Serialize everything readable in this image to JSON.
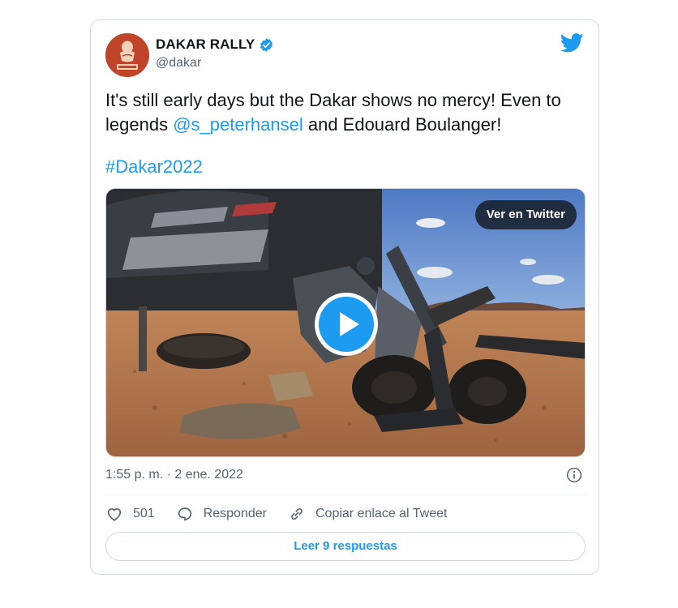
{
  "tweet": {
    "author": {
      "name": "DAKAR RALLY",
      "handle": "@dakar",
      "avatar_icon": "dakar-logo-icon",
      "avatar_color": "#c0442a",
      "verified": true
    },
    "brand_icon": "twitter-bird-icon",
    "text_line1_pre": "It's still early days but the Dakar shows no mercy! Even to",
    "text_line2_pre": "legends ",
    "mention": "@s_peterhansel",
    "text_line2_post": " and Edouard Boulanger!",
    "hashtag": "#Dakar2022",
    "media": {
      "view_label": "Ver en Twitter",
      "play_icon": "play-icon"
    },
    "timestamp": "1:55 p. m. · 2 ene. 2022",
    "info_icon": "info-icon",
    "actions": {
      "like_count": "501",
      "reply_label": "Responder",
      "copy_link_label": "Copiar enlace al Tweet"
    },
    "read_replies_label": "Leer 9 respuestas",
    "colors": {
      "accent": "#1d9bf0",
      "text": "#0f1419",
      "secondary": "#536471",
      "border": "#cfd9de"
    }
  }
}
